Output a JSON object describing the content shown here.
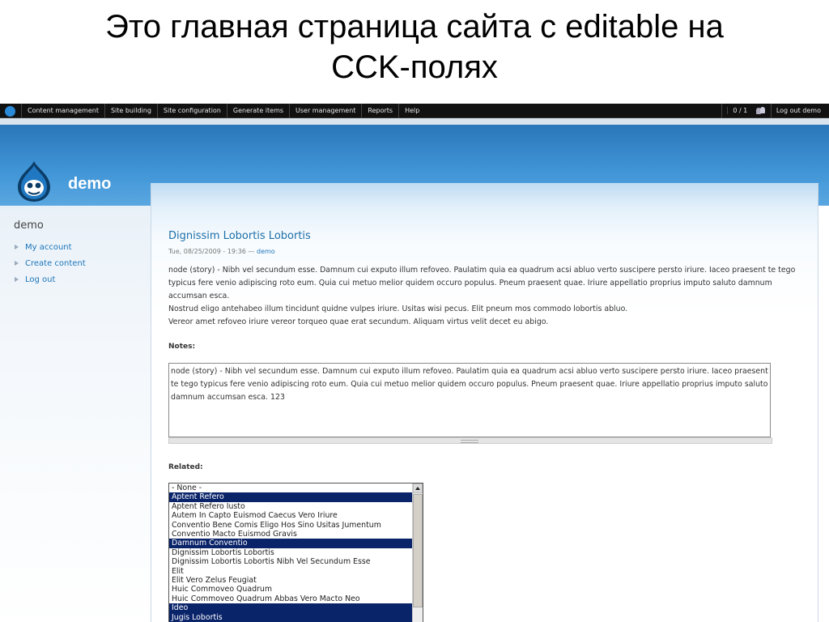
{
  "slide": {
    "title_line1": "Это главная страница сайта с editable на",
    "title_line2": "CCK-полях"
  },
  "admin_menu": {
    "items": [
      "Content management",
      "Site building",
      "Site configuration",
      "Generate items",
      "User management",
      "Reports",
      "Help"
    ],
    "user_count": "0 / 1",
    "logout": "Log out demo"
  },
  "site": {
    "name": "demo"
  },
  "sidebar": {
    "title": "demo",
    "items": [
      "My account",
      "Create content",
      "Log out"
    ]
  },
  "node": {
    "title": "Dignissim Lobortis Lobortis",
    "submitted_date": "Tue, 08/25/2009 - 19:36 —",
    "author": "demo",
    "body_p1": "node (story) - Nibh vel secundum esse. Damnum cui exputo illum refoveo. Paulatim quia ea quadrum acsi abluo verto suscipere persto iriure. Iaceo praesent te tego typicus fere venio adipiscing roto eum. Quia cui metuo melior quidem occuro populus. Pneum praesent quae. Iriure appellatio proprius imputo saluto damnum accumsan esca.",
    "body_p2": "Nostrud eligo antehabeo illum tincidunt quidne vulpes iriure. Usitas wisi pecus. Elit pneum mos commodo lobortis abluo.",
    "body_p3": "Vereor amet refoveo iriure vereor torqueo quae erat secundum. Aliquam virtus velit decet eu abigo.",
    "notes_label": "Notes:",
    "notes_value": "node (story) - Nibh vel secundum esse. Damnum cui exputo illum refoveo. Paulatim quia ea quadrum acsi abluo verto suscipere persto iriure. Iaceo praesent te tego typicus fere venio adipiscing roto eum. Quia cui metuo melior quidem occuro populus. Pneum praesent quae. Iriure appellatio proprius imputo saluto damnum accumsan esca. 123",
    "related_label": "Related:",
    "related_options": [
      {
        "label": "- None -",
        "selected": false
      },
      {
        "label": "Aptent Refero",
        "selected": true
      },
      {
        "label": "Aptent Refero Iusto",
        "selected": false
      },
      {
        "label": "Autem In Capto Euismod Caecus Vero Iriure",
        "selected": false
      },
      {
        "label": "Conventio Bene Comis Eligo Hos Sino Usitas Jumentum",
        "selected": false
      },
      {
        "label": "Conventio Macto Euismod Gravis",
        "selected": false
      },
      {
        "label": "Damnum Conventio",
        "selected": true
      },
      {
        "label": "Dignissim Lobortis Lobortis",
        "selected": false
      },
      {
        "label": "Dignissim Lobortis Lobortis Nibh Vel Secundum Esse",
        "selected": false
      },
      {
        "label": "Elit",
        "selected": false
      },
      {
        "label": "Elit Vero Zelus Feugiat",
        "selected": false
      },
      {
        "label": "Huic Commoveo Quadrum",
        "selected": false
      },
      {
        "label": "Huic Commoveo Quadrum Abbas Vero Macto Neo",
        "selected": false
      },
      {
        "label": "Ideo",
        "selected": true
      },
      {
        "label": "Jugis Lobortis",
        "selected": true
      }
    ]
  }
}
